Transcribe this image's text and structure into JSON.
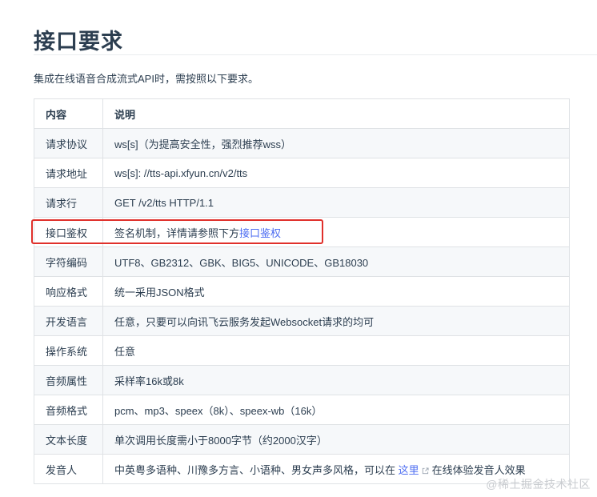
{
  "heading": "接口要求",
  "intro": "集成在线语音合成流式API时，需按照以下要求。",
  "table": {
    "headers": [
      "内容",
      "说明"
    ],
    "rows": [
      {
        "key": "请求协议",
        "value": "ws[s]（为提高安全性，强烈推荐wss）"
      },
      {
        "key": "请求地址",
        "value": "ws[s]: //tts-api.xfyun.cn/v2/tts"
      },
      {
        "key": "请求行",
        "value": "GET /v2/tts HTTP/1.1"
      },
      {
        "key": "接口鉴权",
        "value": "签名机制，详情请参照下方",
        "link": "接口鉴权"
      },
      {
        "key": "字符编码",
        "value": "UTF8、GB2312、GBK、BIG5、UNICODE、GB18030"
      },
      {
        "key": "响应格式",
        "value": "统一采用JSON格式"
      },
      {
        "key": "开发语言",
        "value": "任意，只要可以向讯飞云服务发起Websocket请求的均可"
      },
      {
        "key": "操作系统",
        "value": "任意"
      },
      {
        "key": "音频属性",
        "value": "采样率16k或8k"
      },
      {
        "key": "音频格式",
        "value": "pcm、mp3、speex（8k）、speex-wb（16k）"
      },
      {
        "key": "文本长度",
        "value": "单次调用长度需小于8000字节（约2000汉字）"
      },
      {
        "key": "发音人",
        "value": "中英粤多语种、川豫多方言、小语种、男女声多风格，可以在",
        "link": "这里",
        "value_after": "在线体验发音人效果"
      }
    ]
  },
  "watermark": "@稀土掘金技术社区",
  "colors": {
    "link": "#4e6ef2",
    "highlight_border": "#e0302b",
    "table_border": "#dfe2e5",
    "zebra": "#f6f8fa"
  }
}
